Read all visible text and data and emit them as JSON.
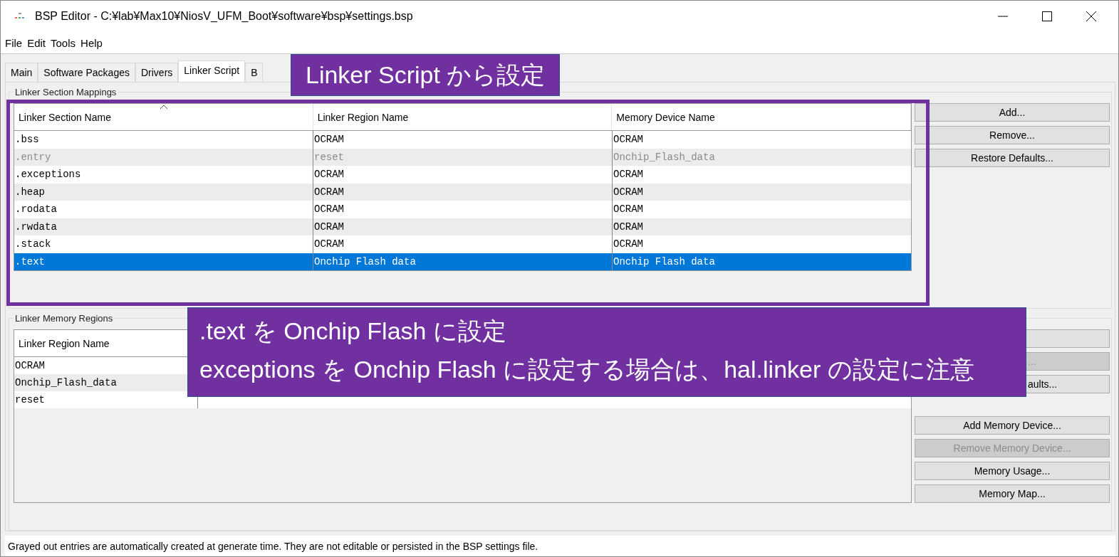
{
  "window": {
    "title": "BSP Editor - C:¥lab¥Max10¥NiosV_UFM_Boot¥software¥bsp¥settings.bsp"
  },
  "menu": [
    "File",
    "Edit",
    "Tools",
    "Help"
  ],
  "tabs": [
    {
      "label": "Main",
      "selected": false
    },
    {
      "label": "Software Packages",
      "selected": false
    },
    {
      "label": "Drivers",
      "selected": false
    },
    {
      "label": "Linker Script",
      "selected": true
    },
    {
      "label": "B",
      "selected": false
    }
  ],
  "section_mappings": {
    "title": "Linker Section Mappings",
    "columns": [
      "Linker Section Name",
      "Linker Region Name",
      "Memory Device Name"
    ],
    "rows": [
      {
        "cells": [
          ".bss",
          "OCRAM",
          "OCRAM"
        ],
        "grayed": false,
        "selected": false
      },
      {
        "cells": [
          ".entry",
          "reset",
          "Onchip_Flash_data"
        ],
        "grayed": true,
        "selected": false
      },
      {
        "cells": [
          ".exceptions",
          "OCRAM",
          "OCRAM"
        ],
        "grayed": false,
        "selected": false
      },
      {
        "cells": [
          ".heap",
          "OCRAM",
          "OCRAM"
        ],
        "grayed": false,
        "selected": false
      },
      {
        "cells": [
          ".rodata",
          "OCRAM",
          "OCRAM"
        ],
        "grayed": false,
        "selected": false
      },
      {
        "cells": [
          ".rwdata",
          "OCRAM",
          "OCRAM"
        ],
        "grayed": false,
        "selected": false
      },
      {
        "cells": [
          ".stack",
          "OCRAM",
          "OCRAM"
        ],
        "grayed": false,
        "selected": false
      },
      {
        "cells": [
          ".text",
          "Onchip Flash data",
          "Onchip Flash data"
        ],
        "grayed": false,
        "selected": true
      }
    ],
    "buttons": [
      {
        "label": "Add...",
        "disabled": false
      },
      {
        "label": "Remove...",
        "disabled": false
      },
      {
        "label": "Restore Defaults...",
        "disabled": false
      }
    ]
  },
  "memory_regions": {
    "title": "Linker Memory Regions",
    "columns": [
      "Linker Region Name"
    ],
    "rows": [
      {
        "cells": [
          "OCRAM"
        ]
      },
      {
        "cells": [
          "Onchip_Flash_data"
        ]
      },
      {
        "cells": [
          "reset"
        ]
      }
    ],
    "buttons": [
      {
        "kind": "covered",
        "disabled": false
      },
      {
        "kind": "clipped",
        "label": "...",
        "disabled": true
      },
      {
        "kind": "clipped",
        "label": "aults...",
        "disabled": false
      },
      {
        "kind": "normal",
        "label": "Add Memory Device...",
        "disabled": false
      },
      {
        "kind": "normal",
        "label": "Remove Memory Device...",
        "disabled": true
      },
      {
        "kind": "normal",
        "label": "Memory Usage...",
        "disabled": false
      },
      {
        "kind": "normal",
        "label": "Memory Map...",
        "disabled": false
      }
    ]
  },
  "status_bar": "Grayed out entries are automatically created at generate time. They are not editable or persisted in the BSP settings file.",
  "callouts": [
    {
      "lines": [
        "Linker Script から設定"
      ]
    },
    {
      "lines": [
        ".text を Onchip Flash に設定",
        "exceptions を Onchip Flash に設定する場合は、hal.linker の設定に注意"
      ]
    }
  ]
}
